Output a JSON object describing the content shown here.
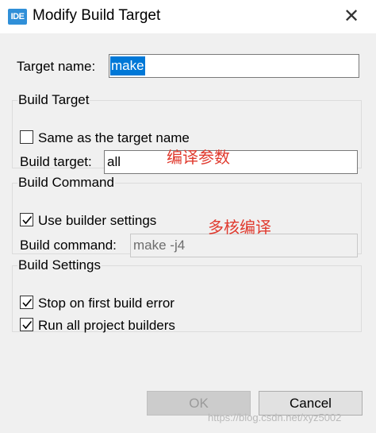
{
  "window": {
    "app_icon_text": "IDE",
    "title": "Modify Build Target",
    "close_glyph": "✕"
  },
  "target_name": {
    "label": "Target name:",
    "value": "make"
  },
  "build_target_group": {
    "legend": "Build Target",
    "same_as_target_name": {
      "label": "Same as the target name",
      "checked": false
    },
    "build_target": {
      "label": "Build target:",
      "value": "all"
    },
    "annotation": "编译参数"
  },
  "build_command_group": {
    "legend": "Build Command",
    "use_builder_settings": {
      "label": "Use builder settings",
      "checked": true
    },
    "build_command": {
      "label": "Build command:",
      "value": "make -j4"
    },
    "annotation": "多核编译"
  },
  "build_settings_group": {
    "legend": "Build Settings",
    "stop_on_first_error": {
      "label": "Stop on first build error",
      "checked": true
    },
    "run_all_builders": {
      "label": "Run all project builders",
      "checked": true
    }
  },
  "buttons": {
    "ok_label": "OK",
    "cancel_label": "Cancel"
  },
  "watermark": "https://blog.csdn.net/xyz5002",
  "colors": {
    "selection": "#0078d7",
    "annotation_red": "#e03a2e",
    "dialog_bg": "#f0f0f0",
    "icon_blue": "#2f8fd8"
  },
  "icons": {
    "app": "ide-app-icon",
    "close": "close-icon",
    "check": "checkmark-icon"
  }
}
